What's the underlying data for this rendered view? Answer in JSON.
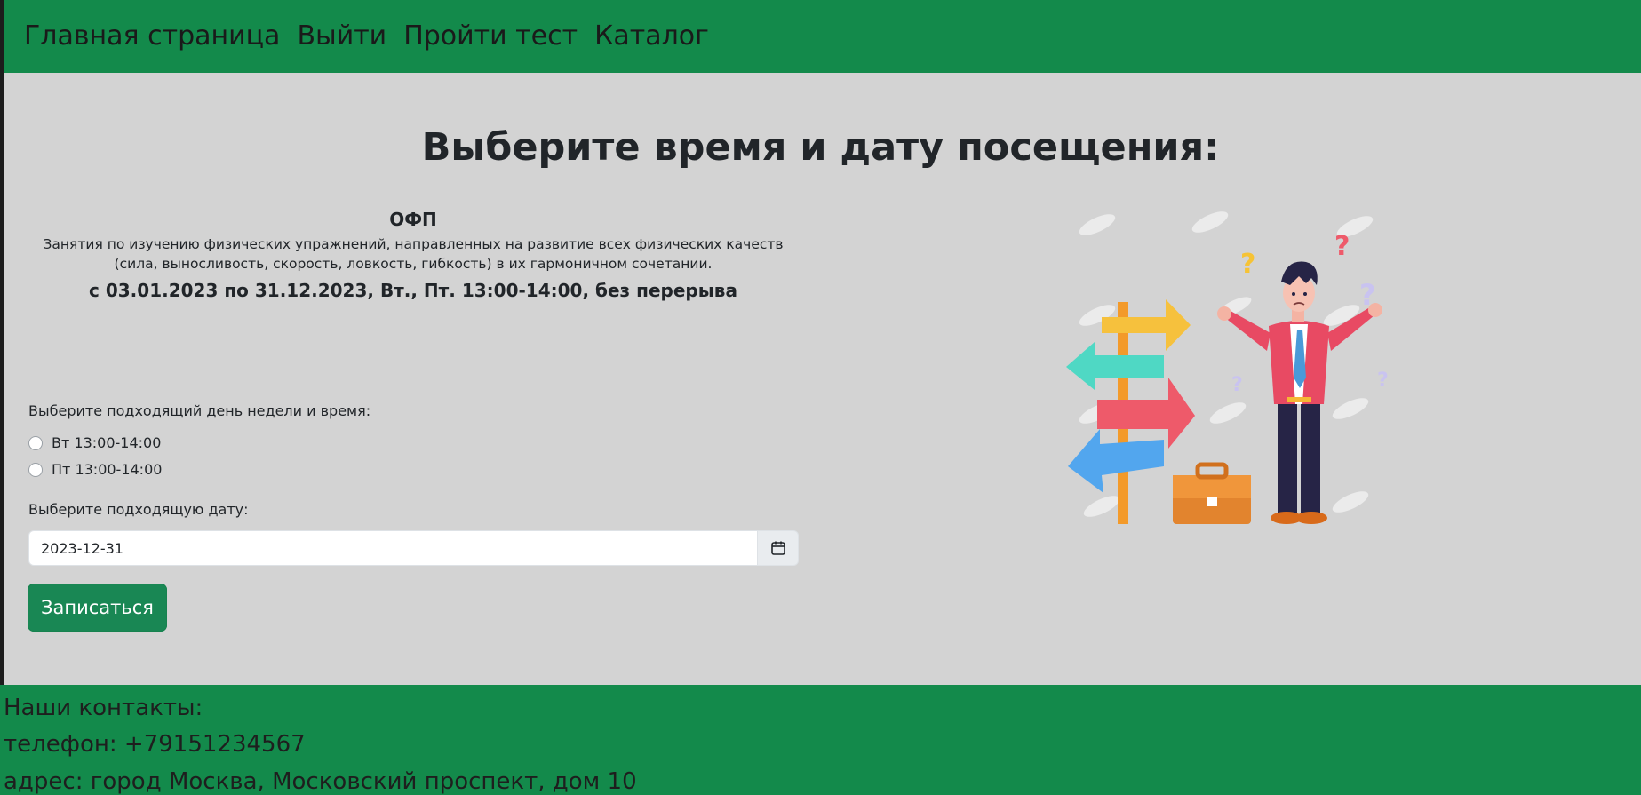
{
  "nav": {
    "items": [
      {
        "label": "Главная страница"
      },
      {
        "label": "Выйти"
      },
      {
        "label": "Пройти тест"
      },
      {
        "label": "Каталог"
      }
    ]
  },
  "page": {
    "title": "Выберите время и дату посещения:"
  },
  "course": {
    "name": "ОФП",
    "description": "Занятия по изучению физических упражнений, направленных на развитие всех физических качеств (сила, выносливость, скорость, ловкость, гибкость) в их гармоничном сочетании.",
    "schedule": "с 03.01.2023 по 31.12.2023, Вт., Пт. 13:00-14:00, без перерыва"
  },
  "form": {
    "day_label": "Выберите подходящий день недели и время:",
    "options": [
      {
        "label": "Вт 13:00-14:00",
        "selected": false
      },
      {
        "label": "Пт 13:00-14:00",
        "selected": false
      }
    ],
    "date_label": "Выберите подходящую дату:",
    "date_value": "2023-12-31",
    "submit_label": "Записаться"
  },
  "footer": {
    "heading": "Наши контакты:",
    "phone": "телефон: +79151234567",
    "address": "адрес: город Москва, Московский проспект, дом 10"
  },
  "colors": {
    "header_bg": "#138a4b",
    "page_bg": "#d3d3d3",
    "button_bg": "#198754",
    "footer_bg": "#138a4b"
  },
  "icons": {
    "calendar": "calendar-icon",
    "illustration": "confused-man-signpost-illustration"
  }
}
